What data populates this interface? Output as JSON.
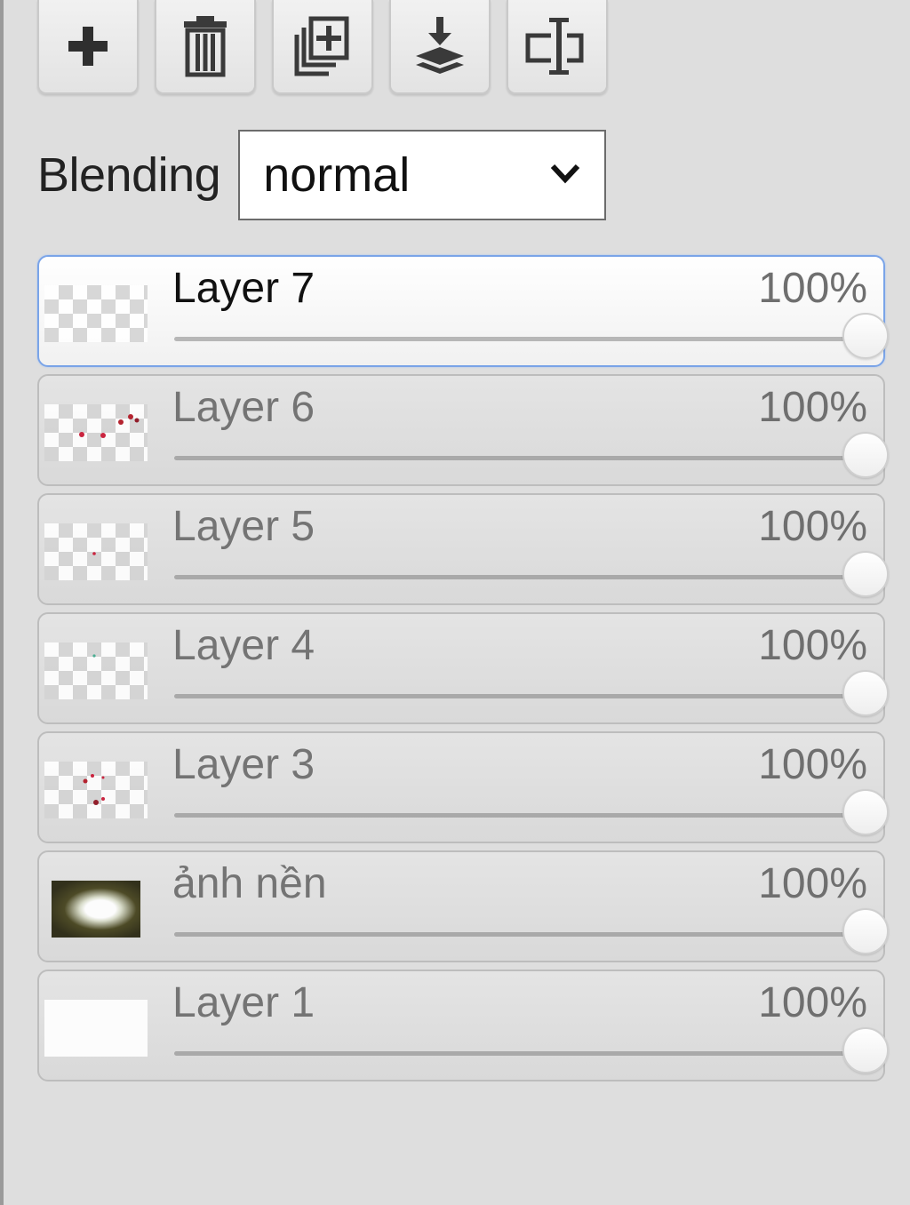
{
  "toolbar": {
    "buttons": [
      {
        "icon": "plus-icon"
      },
      {
        "icon": "trash-icon"
      },
      {
        "icon": "duplicate-icon"
      },
      {
        "icon": "merge-down-icon"
      },
      {
        "icon": "rename-icon"
      }
    ]
  },
  "blending": {
    "label": "Blending",
    "value": "normal"
  },
  "layers": [
    {
      "name": "Layer 7",
      "opacity_label": "100%",
      "opacity": 1.0,
      "active": true,
      "thumb": "transparent"
    },
    {
      "name": "Layer 6",
      "opacity_label": "100%",
      "opacity": 1.0,
      "active": false,
      "thumb": "transparent"
    },
    {
      "name": "Layer 5",
      "opacity_label": "100%",
      "opacity": 1.0,
      "active": false,
      "thumb": "transparent"
    },
    {
      "name": "Layer 4",
      "opacity_label": "100%",
      "opacity": 1.0,
      "active": false,
      "thumb": "transparent"
    },
    {
      "name": "Layer 3",
      "opacity_label": "100%",
      "opacity": 1.0,
      "active": false,
      "thumb": "transparent"
    },
    {
      "name": "ảnh nền",
      "opacity_label": "100%",
      "opacity": 1.0,
      "active": false,
      "thumb": "photo"
    },
    {
      "name": "Layer 1",
      "opacity_label": "100%",
      "opacity": 1.0,
      "active": false,
      "thumb": "white"
    }
  ],
  "colors": {
    "active_border": "#7aa4e8",
    "panel_bg": "#dedede"
  }
}
